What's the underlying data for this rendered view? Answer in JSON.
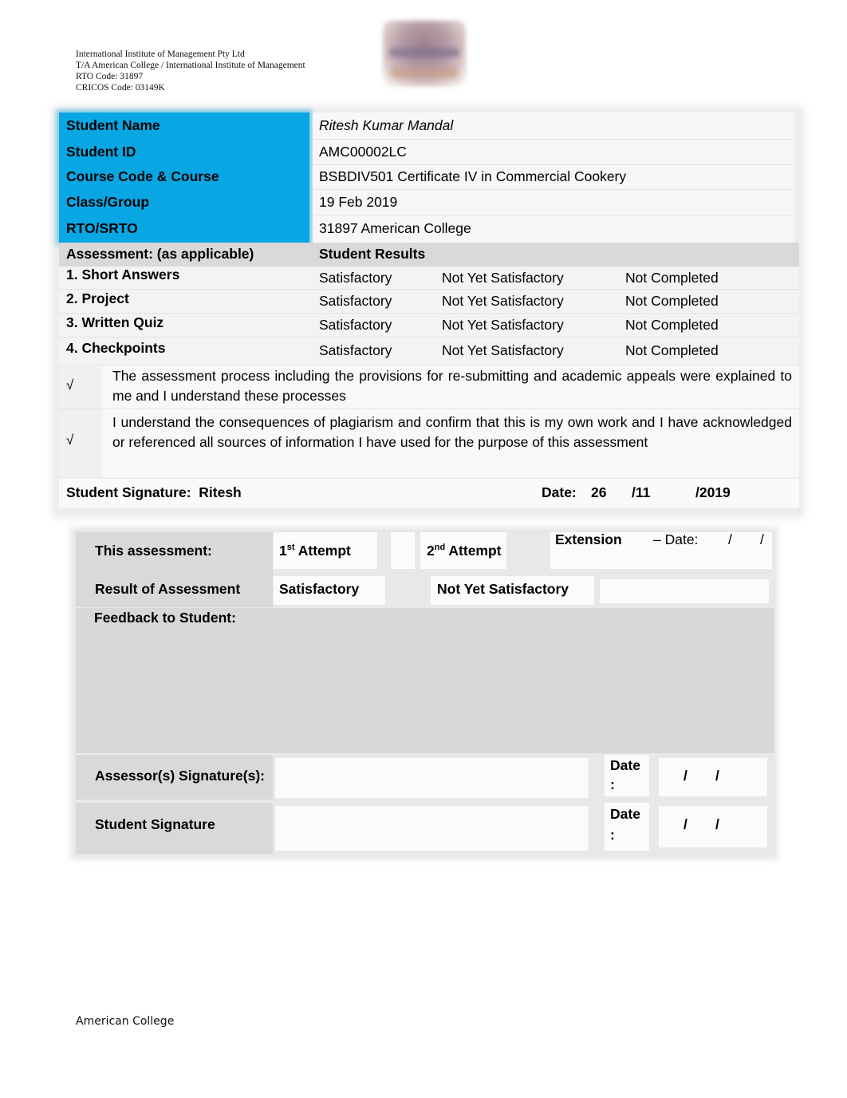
{
  "org_header": {
    "lines": [
      "International Institute of Management Pty Ltd",
      "T/A American College / International Institute of Management",
      "RTO Code: 31897",
      "CRICOS Code: 03149K"
    ],
    "logo_icon": "college-logo"
  },
  "student_info": [
    {
      "label": "Student Name",
      "value": "Ritesh Kumar Mandal"
    },
    {
      "label": "Student ID",
      "value": "AMC00002LC"
    },
    {
      "label": "Course Code & Course",
      "value": "BSBDIV501 Certificate IV in Commercial Cookery"
    },
    {
      "label": "Class/Group",
      "value": "19 Feb 2019"
    },
    {
      "label": "RTO/SRTO",
      "value": "31897 American College"
    }
  ],
  "colors": {
    "accent_blue": "#08a7e4",
    "header_gray": "#d9d9d9",
    "feedback_gray": "#d8d8d8"
  },
  "assessment": {
    "heading": "Assessment: (as applicable)",
    "results_heading": "Student Results",
    "items": [
      {
        "label": "1. Short Answers",
        "options": [
          "Satisfactory",
          "Not Yet Satisfactory",
          "Not Completed"
        ]
      },
      {
        "label": "2. Project",
        "options": [
          "Satisfactory",
          "Not Yet Satisfactory",
          "Not Completed"
        ]
      },
      {
        "label": "3. Written Quiz",
        "options": [
          "Satisfactory",
          "Not Yet Satisfactory",
          "Not Completed"
        ]
      },
      {
        "label": "4. Checkpoints",
        "options": [
          "Satisfactory",
          "Not Yet Satisfactory",
          "Not Completed"
        ]
      }
    ]
  },
  "declarations": [
    {
      "tick": "√",
      "text": "The assessment process including the provisions for re-submitting and academic appeals were explained to me and I understand these processes"
    },
    {
      "tick": "√",
      "text": "I understand the consequences of plagiarism and confirm that this is my own work and I have acknowledged or referenced all sources of information I have used for the purpose of this assessment"
    }
  ],
  "student_signature": {
    "label": "Student Signature:",
    "value": "Ritesh",
    "date_label": "Date:",
    "day": "26",
    "month": "/11",
    "year": "/2019"
  },
  "assessor_section": {
    "this_assessment_label": "This assessment:",
    "first_attempt_num": "1",
    "first_attempt_sup": "st",
    "first_attempt_text": " Attempt",
    "second_attempt_num": "2",
    "second_attempt_sup": "nd",
    "second_attempt_text": " Attempt",
    "extension_label": "Extension",
    "extension_date": "– Date:",
    "extension_slash1": "/",
    "extension_slash2": "/",
    "result_label": "Result of Assessment",
    "result_satisfactory": "Satisfactory",
    "result_not_yet": "Not Yet Satisfactory",
    "feedback_label": "Feedback to Student:",
    "feedback_value": "",
    "assessor_sig_label": "Assessor(s) Signature(s):",
    "student_sig_label": "Student Signature",
    "date_label": "Date",
    "date_colon": ":",
    "slash": "/"
  },
  "footer": {
    "text": "American College"
  }
}
